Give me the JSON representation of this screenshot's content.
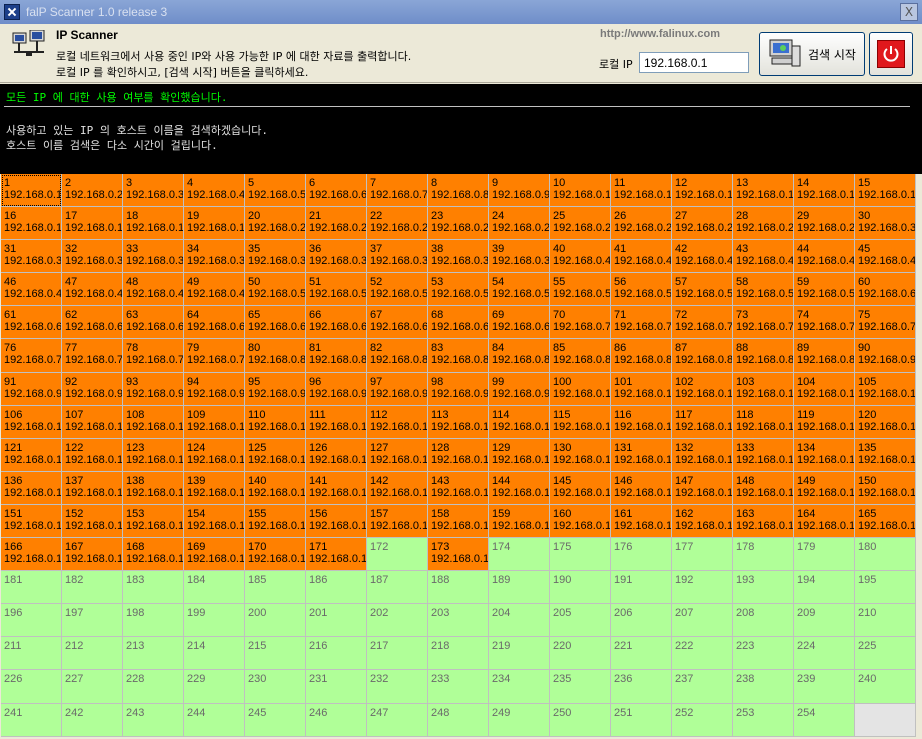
{
  "window": {
    "title": "falP Scanner 1.0 release 3",
    "close_label": "X"
  },
  "header": {
    "app_name": "IP Scanner",
    "description_1": "로컬 네트워크에서 사용 중인 IP와 사용 가능한 IP 에 대한 자료를 출력합니다.",
    "description_2": "로컬 IP 를 확인하시고, [검색 시작] 버튼을 클릭하세요.",
    "url": "http://www.falinux.com",
    "local_ip_label": "로컬 IP",
    "local_ip_value": "192.168.0.1",
    "scan_button_label": "검색 시작"
  },
  "console": {
    "status_line": "모든 IP 에 대한 사용 여부를 확인했습니다.",
    "message_1": "사용하고 있는 IP 의 호스트 이름을 검색하겠습니다.",
    "message_2": "호스트 이름 검색은 다소 시간이 걸립니다."
  },
  "grid": {
    "columns": 15,
    "total_cells": 255,
    "last_host": 254,
    "ip_prefix": "192.168.0.",
    "used_hosts": [
      1,
      2,
      3,
      4,
      5,
      6,
      7,
      8,
      9,
      10,
      11,
      12,
      13,
      14,
      15,
      16,
      17,
      18,
      19,
      20,
      21,
      22,
      23,
      24,
      25,
      26,
      27,
      28,
      29,
      30,
      31,
      32,
      33,
      34,
      35,
      36,
      37,
      38,
      39,
      40,
      41,
      42,
      43,
      44,
      45,
      46,
      47,
      48,
      49,
      50,
      51,
      52,
      53,
      54,
      55,
      56,
      57,
      58,
      59,
      60,
      61,
      62,
      63,
      64,
      65,
      66,
      67,
      68,
      69,
      70,
      71,
      72,
      73,
      74,
      75,
      76,
      77,
      78,
      79,
      80,
      81,
      82,
      83,
      84,
      85,
      86,
      87,
      88,
      89,
      90,
      91,
      92,
      93,
      94,
      95,
      96,
      97,
      98,
      99,
      100,
      101,
      102,
      103,
      104,
      105,
      106,
      107,
      108,
      109,
      110,
      111,
      112,
      113,
      114,
      115,
      116,
      117,
      118,
      119,
      120,
      121,
      122,
      123,
      124,
      125,
      126,
      127,
      128,
      129,
      130,
      131,
      132,
      133,
      134,
      135,
      136,
      137,
      138,
      139,
      140,
      141,
      142,
      143,
      144,
      145,
      146,
      147,
      148,
      149,
      150,
      151,
      152,
      153,
      154,
      155,
      156,
      157,
      158,
      159,
      160,
      161,
      162,
      163,
      164,
      165,
      166,
      167,
      168,
      169,
      170,
      171,
      173
    ],
    "focused_host": 1,
    "colors": {
      "used": "#ff8000",
      "free": "#b0ff98",
      "empty": "#e4e4e4"
    }
  },
  "icons": {
    "app": "falp-logo-icon",
    "network": "network-computers-icon",
    "scan": "computer-scan-icon",
    "power": "power-icon"
  }
}
